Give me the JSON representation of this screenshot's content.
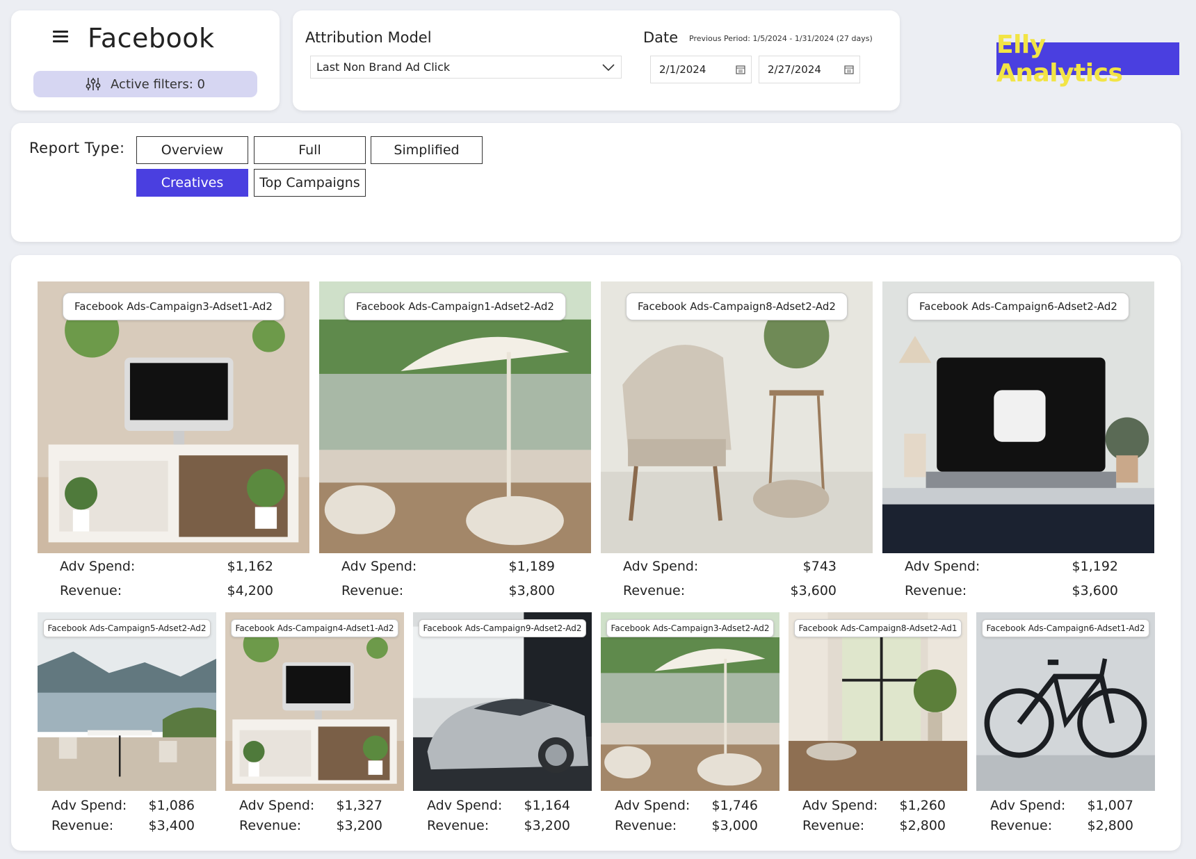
{
  "header": {
    "title": "Facebook",
    "active_filters": "Active filters: 0"
  },
  "attribution": {
    "label": "Attribution Model",
    "selected": "Last Non Brand Ad Click"
  },
  "date": {
    "label": "Date",
    "previous_period": "Previous Period: 1/5/2024 - 1/31/2024 (27 days)",
    "start": "2/1/2024",
    "end": "2/27/2024"
  },
  "logo": {
    "text": "Elly Analytics",
    "bg": "#4a3fe0",
    "fg": "#f2e445"
  },
  "report_type": {
    "label": "Report Type:",
    "options": [
      "Overview",
      "Full",
      "Simplified",
      "Creatives",
      "Top Campaigns"
    ],
    "selected": "Creatives"
  },
  "metric_labels": {
    "spend": "Adv Spend:",
    "revenue": "Revenue:"
  },
  "creatives": [
    {
      "name": "Facebook Ads-Campaign3-Adset1-Ad2",
      "spend": "$1,162",
      "revenue": "$4,200",
      "scene": "desk-imac"
    },
    {
      "name": "Facebook Ads-Campaign1-Adset2-Ad2",
      "spend": "$1,189",
      "revenue": "$3,800",
      "scene": "lake-umbrella"
    },
    {
      "name": "Facebook Ads-Campaign8-Adset2-Ad2",
      "spend": "$743",
      "revenue": "$3,600",
      "scene": "chair-interior"
    },
    {
      "name": "Facebook Ads-Campaign6-Adset2-Ad2",
      "spend": "$1,192",
      "revenue": "$3,600",
      "scene": "laptop-desk"
    },
    {
      "name": "Facebook Ads-Campaign5-Adset2-Ad2",
      "spend": "$1,086",
      "revenue": "$3,400",
      "scene": "lake-terrace"
    },
    {
      "name": "Facebook Ads-Campaign4-Adset1-Ad2",
      "spend": "$1,327",
      "revenue": "$3,200",
      "scene": "desk-imac"
    },
    {
      "name": "Facebook Ads-Campaign9-Adset2-Ad2",
      "spend": "$1,164",
      "revenue": "$3,200",
      "scene": "sports-car"
    },
    {
      "name": "Facebook Ads-Campaign3-Adset2-Ad2",
      "spend": "$1,746",
      "revenue": "$3,000",
      "scene": "lake-umbrella"
    },
    {
      "name": "Facebook Ads-Campaign8-Adset2-Ad1",
      "spend": "$1,260",
      "revenue": "$2,800",
      "scene": "window-room"
    },
    {
      "name": "Facebook Ads-Campaign6-Adset1-Ad2",
      "spend": "$1,007",
      "revenue": "$2,800",
      "scene": "bicycle"
    }
  ]
}
